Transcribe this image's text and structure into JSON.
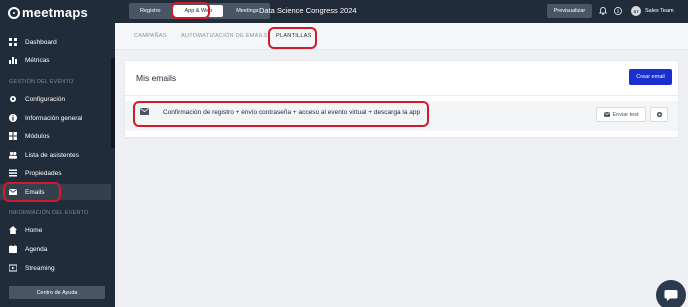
{
  "brand": {
    "logo_text": "meetmaps"
  },
  "sidebar": {
    "top_items": [
      {
        "label": "Dashboard",
        "icon": "grid-icon"
      },
      {
        "label": "Métricas",
        "icon": "chart-icon"
      }
    ],
    "section_event": "GESTIÓN DEL EVENTO",
    "event_items": [
      {
        "label": "Configuración",
        "icon": "gear-icon"
      },
      {
        "label": "Información general",
        "icon": "info-icon"
      },
      {
        "label": "Módulos",
        "icon": "modules-icon"
      },
      {
        "label": "Lista de asistentes",
        "icon": "users-icon"
      },
      {
        "label": "Propiedades",
        "icon": "list-icon"
      },
      {
        "label": "Emails",
        "icon": "envelope-icon",
        "active": true
      }
    ],
    "section_info": "INFORMACIÓN DEL EVENTO",
    "info_items": [
      {
        "label": "Home",
        "icon": "home-icon"
      },
      {
        "label": "Agenda",
        "icon": "calendar-icon"
      },
      {
        "label": "Streaming",
        "icon": "streaming-icon"
      }
    ],
    "help_label": "Centro de Ayuda"
  },
  "topbar": {
    "tabs": [
      "Registro",
      "App & Web",
      "Meetings"
    ],
    "active_tab": "App & Web",
    "event_title": "Data Science Congress 2024",
    "preview_label": "Previsualizar",
    "user_initials": "ST",
    "user_name": "Sales Team"
  },
  "subtabs": {
    "items": [
      "CAMPAÑAS",
      "AUTOMATIZACIÓN DE EMAILS",
      "PLANTILLAS"
    ],
    "active": "PLANTILLAS"
  },
  "main": {
    "title": "Mis emails",
    "create_label": "Crear email",
    "emails": [
      {
        "title": "Confirmación de registro + envío contraseña + acceso al evento virtual + descarga la app",
        "send_label": "Enviar test"
      }
    ]
  },
  "colors": {
    "sidebar_bg": "#212c3a",
    "accent": "#1a2fcf",
    "annotation": "#d11a2a"
  }
}
